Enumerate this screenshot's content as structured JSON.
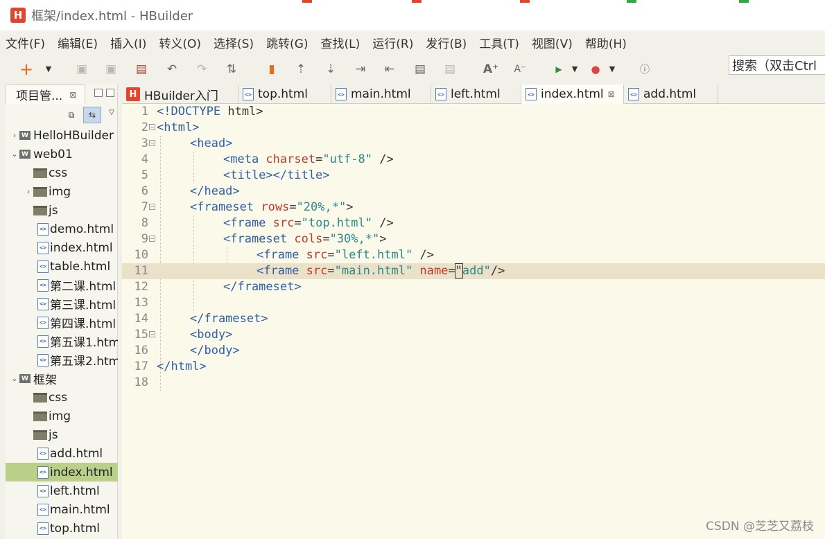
{
  "window": {
    "title": "框架/index.html - HBuilder",
    "logo_letter": "H"
  },
  "menu": [
    "文件(F)",
    "编辑(E)",
    "插入(I)",
    "转义(O)",
    "选择(S)",
    "跳转(G)",
    "查找(L)",
    "运行(R)",
    "发行(B)",
    "工具(T)",
    "视图(V)",
    "帮助(H)"
  ],
  "toolbar": {
    "search_text": "搜索（双击Ctrl",
    "icons": [
      "new-icon",
      "save-icon",
      "save-all-icon",
      "preview-icon",
      "undo-icon",
      "redo-icon",
      "format-icon",
      "bookmark-icon",
      "goto-top-icon",
      "goto-bottom-icon",
      "indent-icon",
      "outdent-icon",
      "comment-icon",
      "uncomment-icon",
      "font-increase-icon",
      "font-decrease-icon",
      "run-icon",
      "chrome-icon",
      "info-icon"
    ]
  },
  "project_panel": {
    "tab_label": "项目管...",
    "tree": [
      {
        "label": "HelloHBuilder",
        "type": "project",
        "expanded": false
      },
      {
        "label": "web01",
        "type": "project",
        "expanded": true
      },
      {
        "label": "css",
        "type": "folder"
      },
      {
        "label": "img",
        "type": "folder",
        "expandable": true
      },
      {
        "label": "js",
        "type": "folder"
      },
      {
        "label": "demo.html",
        "type": "file"
      },
      {
        "label": "index.html",
        "type": "file"
      },
      {
        "label": "table.html",
        "type": "file"
      },
      {
        "label": "第二课.html",
        "type": "file"
      },
      {
        "label": "第三课.html",
        "type": "file"
      },
      {
        "label": "第四课.html",
        "type": "file"
      },
      {
        "label": "第五课1.html",
        "type": "file"
      },
      {
        "label": "第五课2.html",
        "type": "file"
      },
      {
        "label": "框架",
        "type": "project",
        "expanded": true
      },
      {
        "label": "css",
        "type": "folder"
      },
      {
        "label": "img",
        "type": "folder"
      },
      {
        "label": "js",
        "type": "folder"
      },
      {
        "label": "add.html",
        "type": "file"
      },
      {
        "label": "index.html",
        "type": "file",
        "selected": true
      },
      {
        "label": "left.html",
        "type": "file"
      },
      {
        "label": "main.html",
        "type": "file"
      },
      {
        "label": "top.html",
        "type": "file"
      }
    ]
  },
  "tabs": [
    {
      "label": "HBuilder入门",
      "icon": "hbuilder-icon"
    },
    {
      "label": "top.html",
      "icon": "html-file-icon"
    },
    {
      "label": "main.html",
      "icon": "html-file-icon"
    },
    {
      "label": "left.html",
      "icon": "html-file-icon"
    },
    {
      "label": "index.html",
      "icon": "html-file-icon",
      "active": true,
      "close": "⊠"
    },
    {
      "label": "add.html",
      "icon": "html-file-icon"
    }
  ],
  "editor": {
    "current_line": 11,
    "lines": [
      {
        "n": "1",
        "fold": false,
        "indent": 0,
        "tokens": [
          [
            "tg",
            "<!DOCTYPE "
          ],
          [
            "pl",
            "html>"
          ]
        ]
      },
      {
        "n": "2",
        "fold": true,
        "indent": 0,
        "tokens": [
          [
            "tg",
            "<html>"
          ]
        ]
      },
      {
        "n": "3",
        "fold": true,
        "indent": 1,
        "tokens": [
          [
            "tg",
            "<head>"
          ]
        ]
      },
      {
        "n": "4",
        "fold": false,
        "indent": 2,
        "tokens": [
          [
            "tg",
            "<meta "
          ],
          [
            "at",
            "charset"
          ],
          [
            "pl",
            "="
          ],
          [
            "vl",
            "\"utf-8\""
          ],
          [
            "pl",
            " />"
          ]
        ]
      },
      {
        "n": "5",
        "fold": false,
        "indent": 2,
        "tokens": [
          [
            "tg",
            "<title></title>"
          ]
        ]
      },
      {
        "n": "6",
        "fold": false,
        "indent": 1,
        "tokens": [
          [
            "tg",
            "</head>"
          ]
        ]
      },
      {
        "n": "7",
        "fold": true,
        "indent": 1,
        "tokens": [
          [
            "tg",
            "<frameset "
          ],
          [
            "at",
            "rows"
          ],
          [
            "pl",
            "="
          ],
          [
            "vl",
            "\"20%,*\""
          ],
          [
            "pl",
            ">"
          ]
        ]
      },
      {
        "n": "8",
        "fold": false,
        "indent": 2,
        "tokens": [
          [
            "tg",
            "<frame "
          ],
          [
            "at",
            "src"
          ],
          [
            "pl",
            "="
          ],
          [
            "vl",
            "\"top.html\""
          ],
          [
            "pl",
            " />"
          ]
        ]
      },
      {
        "n": "9",
        "fold": true,
        "indent": 2,
        "tokens": [
          [
            "tg",
            "<frameset "
          ],
          [
            "at",
            "cols"
          ],
          [
            "pl",
            "="
          ],
          [
            "vl",
            "\"30%,*\""
          ],
          [
            "pl",
            ">"
          ]
        ]
      },
      {
        "n": "10",
        "fold": false,
        "indent": 3,
        "tokens": [
          [
            "tg",
            "<frame "
          ],
          [
            "at",
            "src"
          ],
          [
            "pl",
            "="
          ],
          [
            "vl",
            "\"left.html\""
          ],
          [
            "pl",
            " />"
          ]
        ]
      },
      {
        "n": "11",
        "fold": false,
        "indent": 3,
        "tokens": [
          [
            "tg",
            "<frame "
          ],
          [
            "at",
            "src"
          ],
          [
            "pl",
            "="
          ],
          [
            "vl",
            "\"main.html\""
          ],
          [
            "pl",
            " "
          ],
          [
            "at",
            "name"
          ],
          [
            "pl",
            "="
          ],
          [
            "caret",
            "\""
          ],
          [
            "vl",
            "add\""
          ],
          [
            "pl",
            "/>"
          ]
        ]
      },
      {
        "n": "12",
        "fold": false,
        "indent": 2,
        "tokens": [
          [
            "tg",
            "</frameset>"
          ]
        ]
      },
      {
        "n": "13",
        "fold": false,
        "indent": 2,
        "tokens": []
      },
      {
        "n": "14",
        "fold": false,
        "indent": 1,
        "tokens": [
          [
            "tg",
            "</frameset>"
          ]
        ]
      },
      {
        "n": "15",
        "fold": true,
        "indent": 1,
        "tokens": [
          [
            "tg",
            "<body>"
          ]
        ]
      },
      {
        "n": "16",
        "fold": false,
        "indent": 1,
        "tokens": [
          [
            "tg",
            "</body>"
          ]
        ]
      },
      {
        "n": "17",
        "fold": false,
        "indent": 0,
        "tokens": [
          [
            "tg",
            "</html>"
          ]
        ]
      },
      {
        "n": "18",
        "fold": false,
        "indent": 0,
        "tokens": []
      }
    ]
  },
  "watermark": "CSDN @芝芝又荔枝",
  "colors": {
    "tag": "#2f5fa8",
    "attribute": "#c0392b",
    "value": "#2b8a8a",
    "current_line": "#eae1c8",
    "selected_tree_row": "#b9cf8a",
    "editor_bg": "#fbf9ea"
  }
}
